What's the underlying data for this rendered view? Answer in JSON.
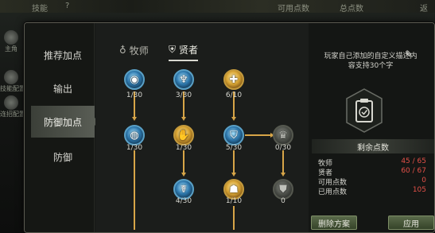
{
  "background": {
    "top_labels": [
      "技能",
      "?",
      "可用点数",
      "总点数",
      "返"
    ],
    "side_items": [
      {
        "label": "主角",
        "icon": "character-icon"
      },
      {
        "label": "技能配置",
        "icon": "skill-config-icon"
      },
      {
        "label": "连招配置",
        "icon": "combo-config-icon"
      }
    ]
  },
  "nav": {
    "items": [
      "推荐加点",
      "输出",
      "防御加点",
      "防御"
    ],
    "active_index": 2
  },
  "tabs": [
    {
      "label": "牧师",
      "icon": "priest-icon"
    },
    {
      "label": "贤者",
      "icon": "sage-shield-icon"
    }
  ],
  "active_tab": 1,
  "tree": {
    "nodes": [
      {
        "id": "r1c1",
        "count": "1/30",
        "state": "blue",
        "icon": "spiral-orb-icon"
      },
      {
        "id": "r1c2",
        "count": "3/30",
        "state": "blue",
        "icon": "angel-figure-icon"
      },
      {
        "id": "r1c3",
        "count": "6/10",
        "state": "gold",
        "icon": "holy-cross-icon"
      },
      {
        "id": "r2c1",
        "count": "1/30",
        "state": "blue",
        "icon": "orb-pin-icon"
      },
      {
        "id": "r2c2",
        "count": "1/30",
        "state": "gold",
        "icon": "winged-hand-icon"
      },
      {
        "id": "r2c3",
        "count": "5/30",
        "state": "blue",
        "icon": "shield-emblem-icon"
      },
      {
        "id": "r2c4",
        "count": "0/30",
        "state": "grey",
        "icon": "dark-crown-icon"
      },
      {
        "id": "r3c2",
        "count": "4/30",
        "state": "blue",
        "icon": "praying-figure-icon"
      },
      {
        "id": "r3c3",
        "count": "1/10",
        "state": "gold",
        "icon": "golden-bell-icon"
      },
      {
        "id": "r3c4",
        "count": "0",
        "state": "grey",
        "icon": "grey-shield-icon"
      }
    ]
  },
  "info": {
    "description": "玩家自己添加的自定义描述内容支持30个字",
    "edit_icon": "edit-pencil-icon",
    "emblem_icon": "clipboard-check-icon",
    "remaining_title": "剩余点数",
    "stats": [
      {
        "label": "牧师",
        "value": "45 / 65"
      },
      {
        "label": "贤者",
        "value": "60 / 67"
      },
      {
        "label": "可用点数",
        "value": "0"
      },
      {
        "label": "已用点数",
        "value": "105"
      }
    ],
    "buttons": {
      "delete": "删除方案",
      "apply": "应用"
    }
  },
  "colors": {
    "accent_gold": "#d7a548",
    "stat_red": "#e25048",
    "button_green": "#4a5a3c"
  }
}
